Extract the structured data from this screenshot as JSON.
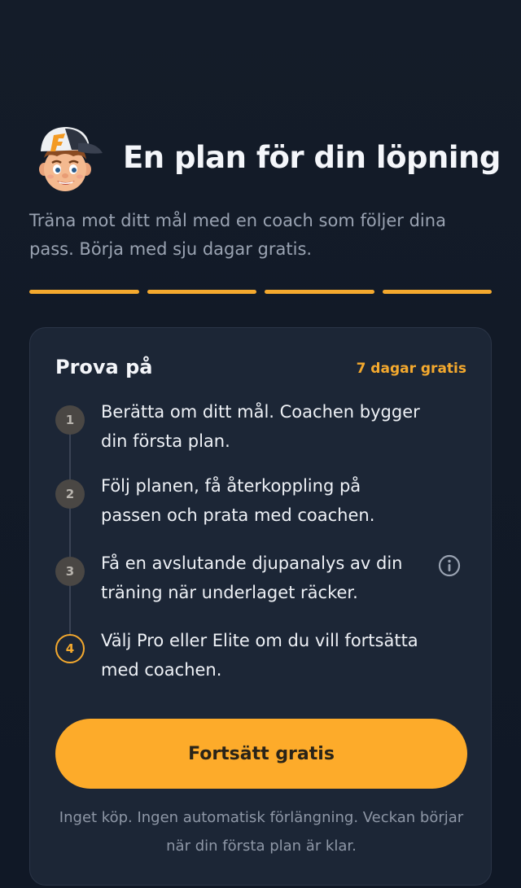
{
  "header": {
    "mascot_icon": "runner-mascot-icon",
    "title": "En plan för din löpning",
    "subtitle": "Träna mot ditt mål med en coach som följer dina pass. Börja med sju dagar gratis."
  },
  "progress": {
    "segments_total": 4,
    "segments_filled": 4,
    "color": "#f4a92e"
  },
  "card": {
    "title": "Prova på",
    "badge": "7 dagar gratis",
    "steps": [
      {
        "number": "1",
        "text": "Berätta om ditt mål. Coachen bygger din första plan."
      },
      {
        "number": "2",
        "text": "Följ planen, få återkoppling på passen och prata med coachen."
      },
      {
        "number": "3",
        "text": "Få en avslutande djupanalys av din träning när underlaget räcker.",
        "icon": "info-icon"
      },
      {
        "number": "4",
        "text": "Välj Pro eller Elite om du vill fortsätta med coachen.",
        "current": true
      }
    ],
    "cta_label": "Fortsätt gratis",
    "footnote": "Inget köp. Ingen automatisk förlängning. Veckan börjar när din första plan är klar."
  },
  "colors": {
    "accent": "#f4a92e",
    "cta_background": "#fdab2a",
    "background": "#131b28",
    "card_background": "#1c2636"
  }
}
